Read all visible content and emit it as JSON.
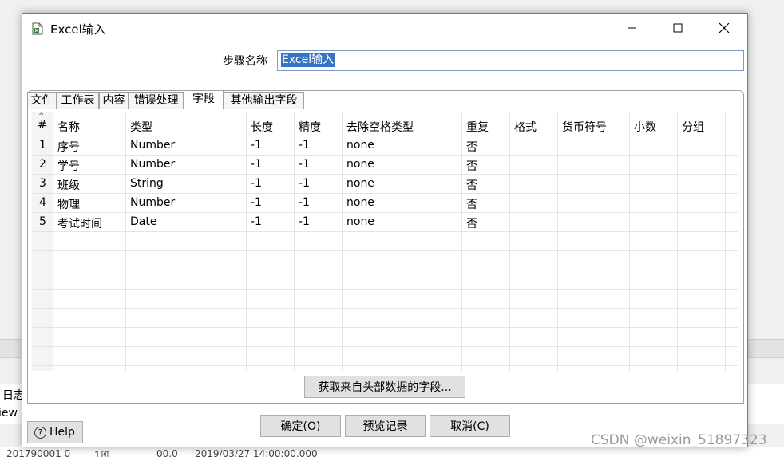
{
  "background": {
    "log_label": "日志",
    "view_label": "iew",
    "bottom_text_1": "201790001 0",
    "bottom_text_2": "1班",
    "bottom_text_3": "00.0",
    "bottom_text_4": "2019/03/27 14:00:00.000"
  },
  "dialog": {
    "title": "Excel输入",
    "step_name_label": "步骤名称",
    "step_name_value": "Excel输入"
  },
  "tabs": [
    {
      "label": "文件"
    },
    {
      "label": "工作表"
    },
    {
      "label": "内容"
    },
    {
      "label": "错误处理"
    },
    {
      "label": "字段",
      "active": true
    },
    {
      "label": "其他输出字段"
    }
  ],
  "table": {
    "sort_indicator": "^",
    "columns": [
      "#",
      "名称",
      "类型",
      "长度",
      "精度",
      "去除空格类型",
      "重复",
      "格式",
      "货币符号",
      "小数",
      "分组"
    ],
    "rows": [
      [
        "1",
        "序号",
        "Number",
        "-1",
        "-1",
        "none",
        "否"
      ],
      [
        "2",
        "学号",
        "Number",
        "-1",
        "-1",
        "none",
        "否"
      ],
      [
        "3",
        "班级",
        "String",
        "-1",
        "-1",
        "none",
        "否"
      ],
      [
        "4",
        "物理",
        "Number",
        "-1",
        "-1",
        "none",
        "否"
      ],
      [
        "5",
        "考试时间",
        "Date",
        "-1",
        "-1",
        "none",
        "否"
      ]
    ]
  },
  "buttons": {
    "get_fields": "获取来自头部数据的字段...",
    "ok": "确定(O)",
    "preview": "预览记录",
    "cancel": "取消(C)",
    "help": "Help",
    "help_icon_glyph": "?"
  },
  "watermark": "CSDN @weixin_51897323"
}
